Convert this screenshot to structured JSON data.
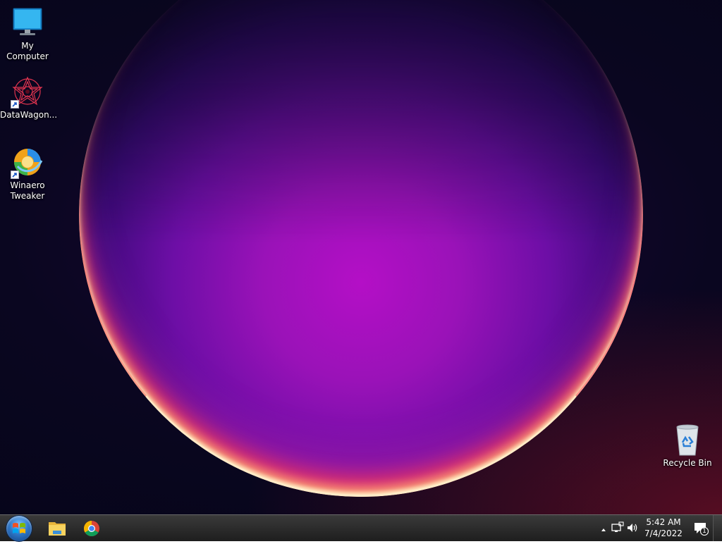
{
  "desktop": {
    "icons": [
      {
        "label": "My Computer",
        "icon": "computer-icon"
      },
      {
        "label": "DataWagon...",
        "icon": "datawagon-icon",
        "shortcut": true
      },
      {
        "label": "Winaero Tweaker",
        "icon": "winaero-tweaker-icon",
        "shortcut": true
      },
      {
        "label": "Recycle Bin",
        "icon": "recycle-bin-icon"
      }
    ]
  },
  "taskbar": {
    "start": {
      "icon": "windows-logo-icon"
    },
    "pinned": [
      {
        "icon": "file-explorer-icon"
      },
      {
        "icon": "chrome-icon"
      }
    ],
    "tray": {
      "icons": [
        "show-hidden-icons-chevron",
        "network-icon",
        "volume-icon"
      ],
      "time": "5:42 AM",
      "date": "7/4/2022",
      "notification_count": "1"
    }
  },
  "colors": {
    "taskbar_bg": "#1e1e1e",
    "wallpaper_base": "#0a0620",
    "orb_core": "#b40fc6",
    "orb_rim": "#ffe6c8"
  }
}
